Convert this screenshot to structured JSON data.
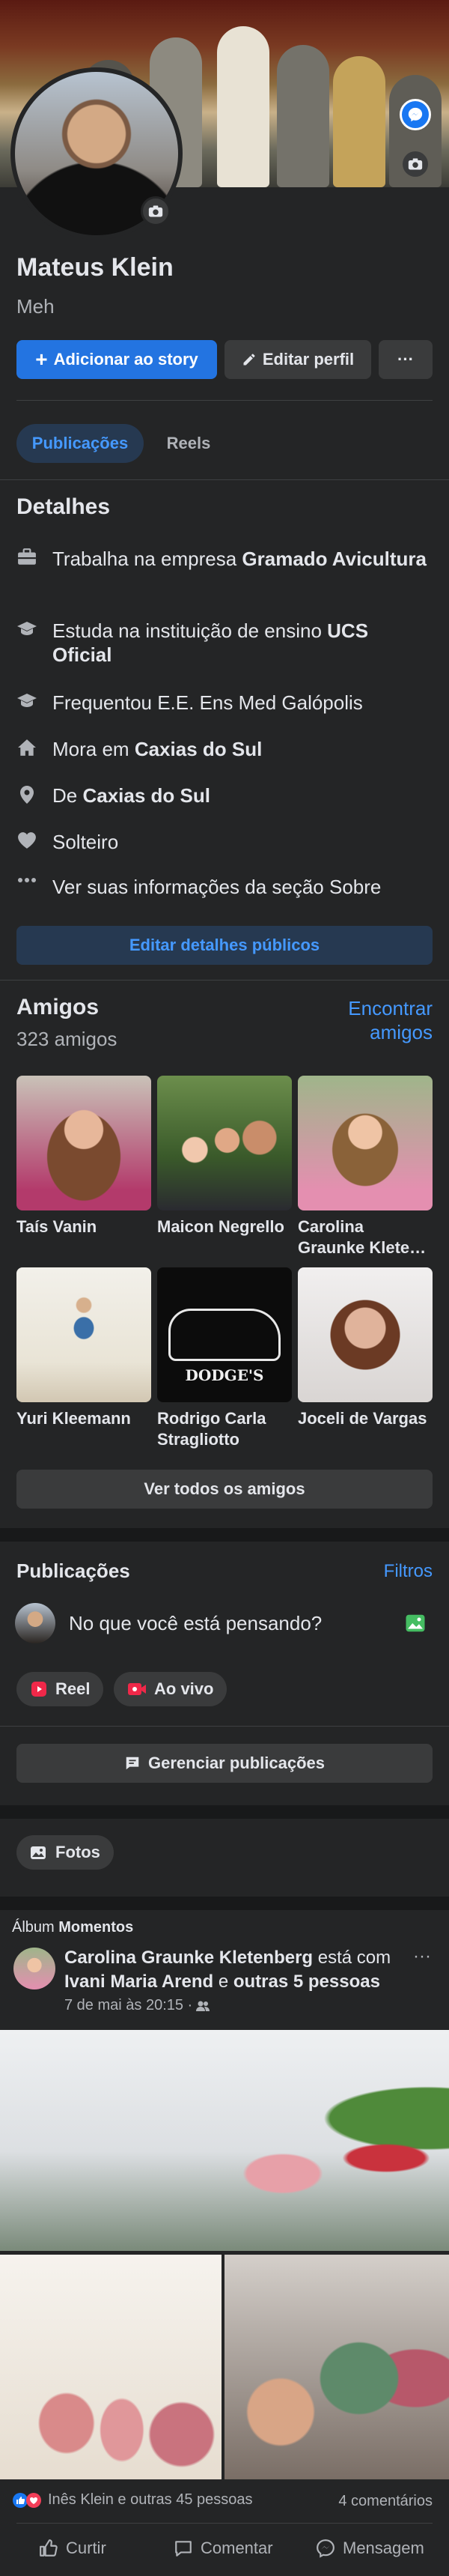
{
  "profile": {
    "name": "Mateus Klein",
    "bio": "Meh"
  },
  "actions": {
    "add_story": "Adicionar ao story",
    "edit_profile": "Editar perfil",
    "more": "···"
  },
  "tabs": [
    {
      "label": "Publicações",
      "active": true
    },
    {
      "label": "Reels",
      "active": false
    }
  ],
  "details": {
    "title": "Detalhes",
    "items": [
      {
        "icon": "briefcase-icon",
        "pre": "Trabalha na empresa ",
        "bold": "Gramado Avicultura"
      },
      {
        "icon": "graduation-cap-icon",
        "pre": "Estuda na instituição de ensino ",
        "bold": "UCS Oficial"
      },
      {
        "icon": "graduation-cap-icon",
        "pre": "Frequentou E.E. Ens Med Galópolis",
        "bold": ""
      },
      {
        "icon": "home-icon",
        "pre": "Mora em ",
        "bold": "Caxias do Sul"
      },
      {
        "icon": "location-pin-icon",
        "pre": "De ",
        "bold": "Caxias do Sul"
      },
      {
        "icon": "heart-icon",
        "pre": "Solteiro",
        "bold": ""
      },
      {
        "icon": "more-dots-icon",
        "pre": "Ver suas informações da seção Sobre",
        "bold": ""
      }
    ],
    "edit_button": "Editar detalhes públicos"
  },
  "friends": {
    "title": "Amigos",
    "count": "323 amigos",
    "find_link": "Encontrar amigos",
    "list": [
      {
        "name": "Taís Vanin"
      },
      {
        "name": "Maicon Negrello"
      },
      {
        "name": "Carolina Graunke Klete…"
      },
      {
        "name": "Yuri Kleemann"
      },
      {
        "name": "Rodrigo Carla Stragliotto"
      },
      {
        "name": "Joceli de Vargas"
      }
    ],
    "see_all": "Ver todos os amigos",
    "dodges_logo_text": "DODGE'S"
  },
  "posts": {
    "title": "Publicações",
    "filters": "Filtros",
    "composer_placeholder": "No que você está pensando?",
    "reel": "Reel",
    "live": "Ao vivo",
    "manage": "Gerenciar publicações",
    "photos": "Fotos"
  },
  "feed_post": {
    "album_prefix": "Álbum ",
    "album_name": "Momentos",
    "author": "Carolina Graunke Kletenberg",
    "with_text": " está com ",
    "tagged": "Ivani Maria Arend",
    "and_text": " e ",
    "others": "outras 5 pessoas",
    "timestamp": "7 de mai às 20:15 · ",
    "reactions_text": "Inês Klein e outras 45 pessoas",
    "comments_text": "4 comentários",
    "like": "Curtir",
    "comment": "Comentar",
    "message": "Mensagem"
  },
  "colors": {
    "accent": "#2374e1",
    "background": "#242526",
    "separator": "#18191a"
  }
}
